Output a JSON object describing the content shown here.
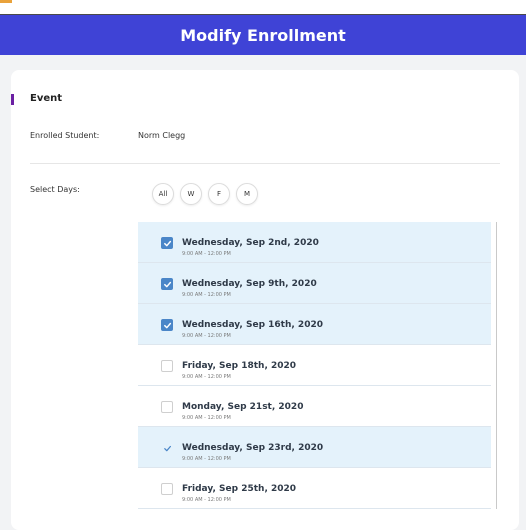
{
  "header": {
    "title": "Modify Enrollment"
  },
  "colors": {
    "header_bg": "#3f43d6",
    "section_marker": "#6b1fa3",
    "selected_row": "#e4f2fb",
    "checkbox": "#4a86c8"
  },
  "section": {
    "title": "Event"
  },
  "fields": {
    "enrolled_student_label": "Enrolled Student:",
    "enrolled_student_value": "Norm Clegg",
    "select_days_label": "Select Days:"
  },
  "day_filters": [
    "All",
    "W",
    "F",
    "M"
  ],
  "sessions": [
    {
      "title": "Wednesday, Sep 2nd, 2020",
      "time": "9:00 AM - 12:00 PM",
      "state": "checked"
    },
    {
      "title": "Wednesday, Sep 9th, 2020",
      "time": "9:00 AM - 12:00 PM",
      "state": "checked"
    },
    {
      "title": "Wednesday, Sep 16th, 2020",
      "time": "9:00 AM - 12:00 PM",
      "state": "checked"
    },
    {
      "title": "Friday, Sep 18th, 2020",
      "time": "9:00 AM - 12:00 PM",
      "state": "unchecked"
    },
    {
      "title": "Monday, Sep 21st, 2020",
      "time": "9:00 AM - 12:00 PM",
      "state": "unchecked"
    },
    {
      "title": "Wednesday, Sep 23rd, 2020",
      "time": "9:00 AM - 12:00 PM",
      "state": "ticked"
    },
    {
      "title": "Friday, Sep 25th, 2020",
      "time": "9:00 AM - 12:00 PM",
      "state": "unchecked"
    }
  ]
}
